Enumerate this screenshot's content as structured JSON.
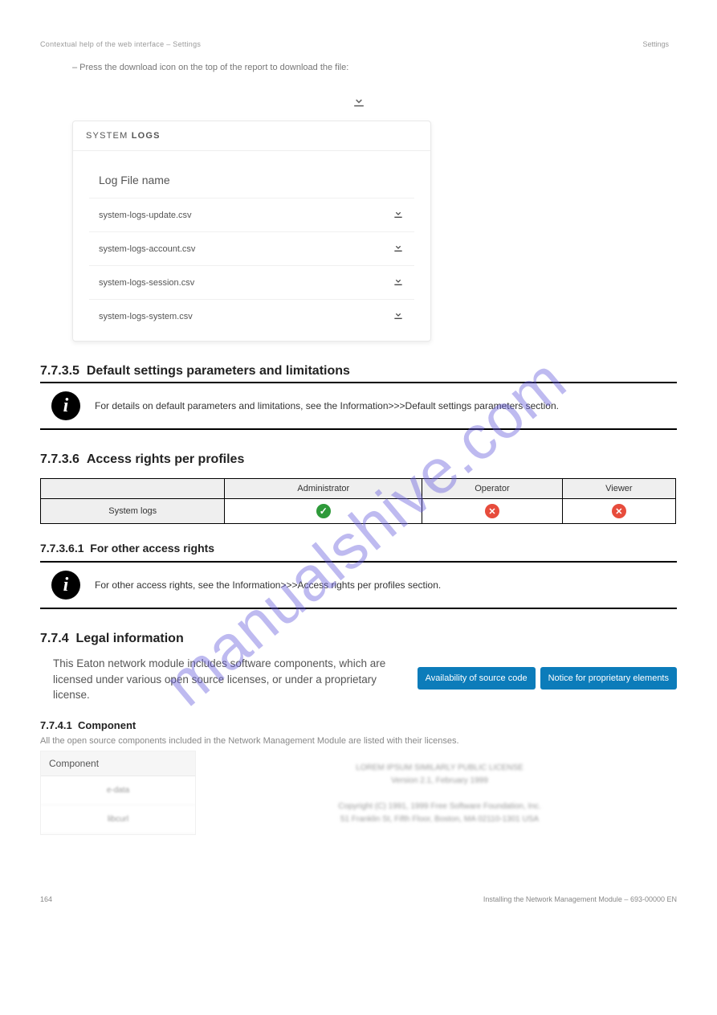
{
  "breadcrumb": {
    "left": "Contextual help of the web interface – Settings",
    "right": "Settings"
  },
  "watermark": "manualshive.com",
  "download_all_prompt": "– Press the download icon on the top of the report to download the file:",
  "card": {
    "title_light": "SYSTEM ",
    "title_bold": "LOGS",
    "column_label": "Log File name",
    "files": [
      {
        "name": "system-logs-update.csv"
      },
      {
        "name": "system-logs-account.csv"
      },
      {
        "name": "system-logs-session.csv"
      },
      {
        "name": "system-logs-system.csv"
      }
    ]
  },
  "section_default": {
    "num": "7.7.3.5",
    "title": "Default settings parameters and limitations",
    "callout": "For details on default parameters and limitations, see the Information>>>Default settings parameters section."
  },
  "section_access": {
    "num": "7.7.3.6",
    "title": "Access rights per profiles",
    "table": {
      "headers": [
        "",
        "Administrator",
        "Operator",
        "Viewer"
      ],
      "row_label": "System logs",
      "row_values": [
        "check",
        "x",
        "x"
      ]
    },
    "callout": "For other access rights  For other access rights, see the Information>>>Access rights per profiles section."
  },
  "section_legal": {
    "num": "7.7.4",
    "title": "Legal information",
    "body": "This Eaton network module includes software components, which are licensed under various open source licenses, or under a proprietary license.",
    "btn1": "Availability of source code",
    "btn2": "Notice for proprietary elements"
  },
  "sub_comp": {
    "num": "7.7.4.1",
    "title": "Component"
  },
  "comp": {
    "header": "Component",
    "items": [
      "e-data",
      "libcurl"
    ],
    "license_blur": [
      "LOREM IPSUM SIMILARLY PUBLIC LICENSE",
      "Version 2.1, February 1999",
      "Copyright (C) 1991, 1999 Free Software Foundation, Inc.",
      "51 Franklin St, Fifth Floor, Boston, MA 02110-1301 USA"
    ]
  },
  "footer": {
    "left": "164",
    "right": "Installing the Network Management Module – 693-00000 EN"
  }
}
